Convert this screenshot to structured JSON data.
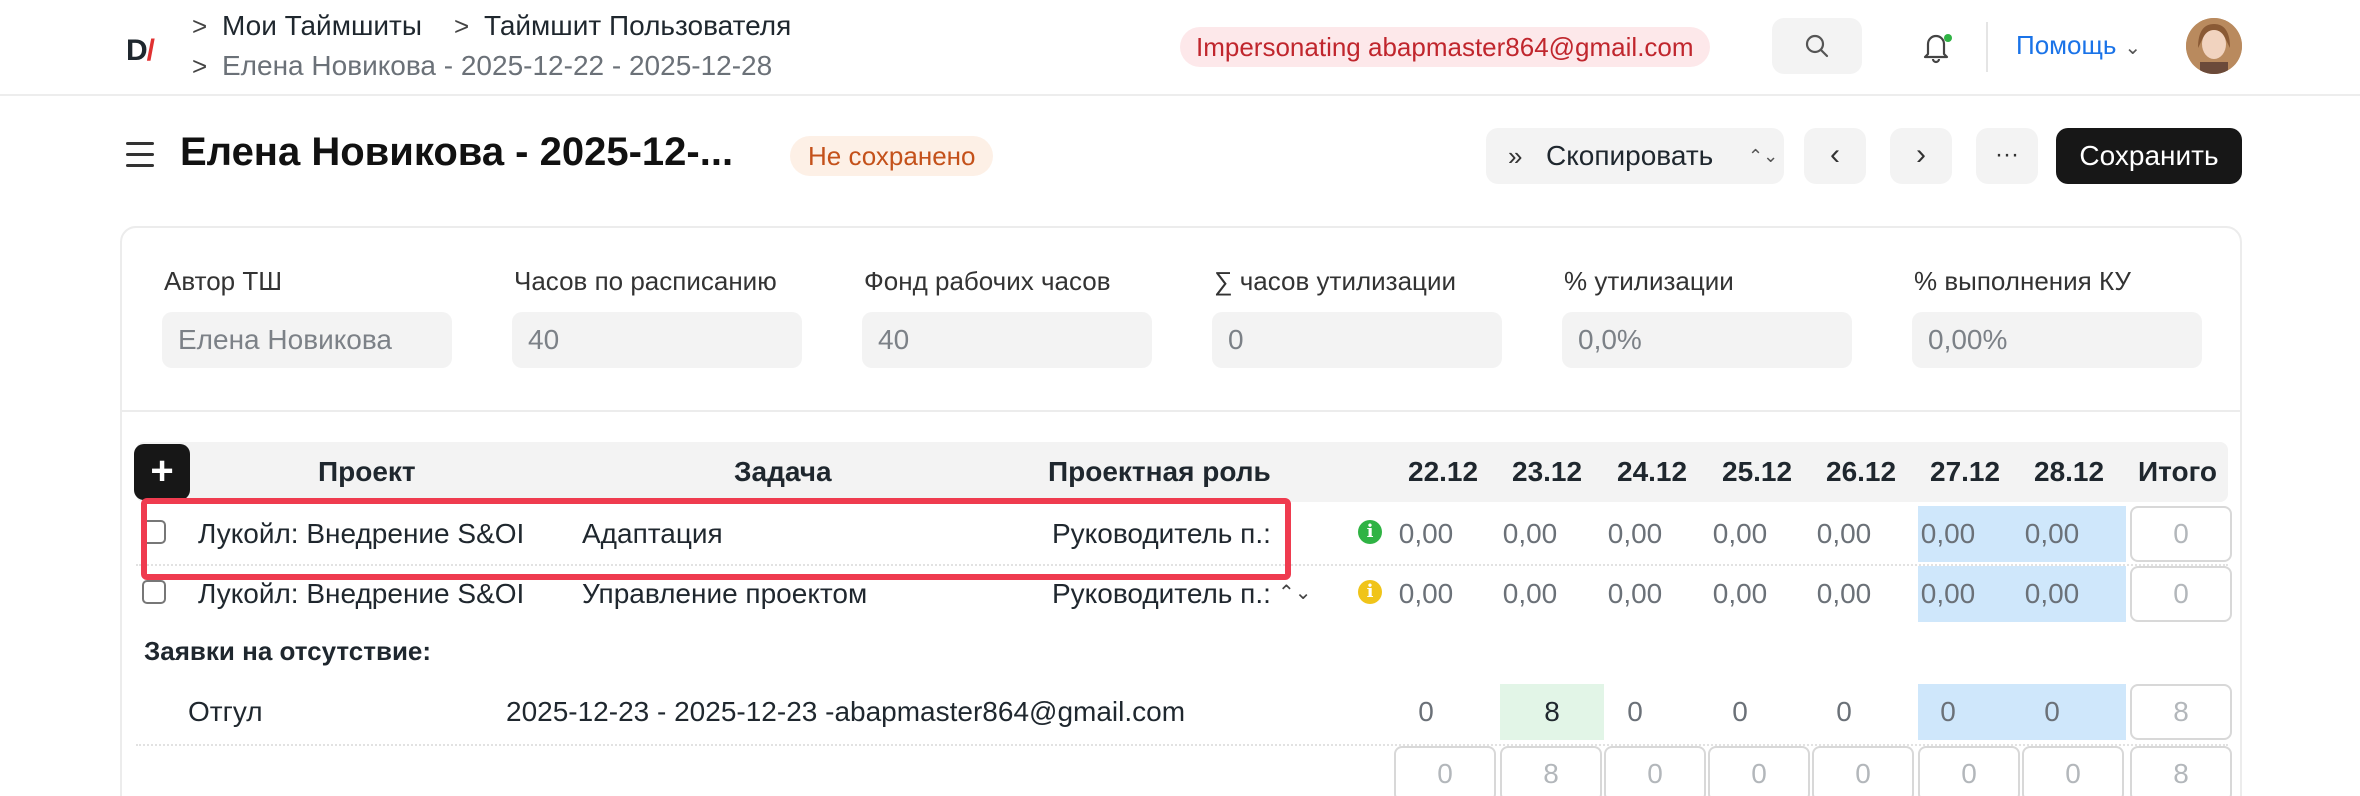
{
  "navbar": {
    "logo_text": "D",
    "logo_slash": "/",
    "breadcrumbs": [
      "Мои Таймшиты",
      "Таймшит Пользователя",
      "Елена Новикова - 2025-12-22 - 2025-12-28"
    ],
    "crumb_separator": ">",
    "impersonation_badge": "Impersonating abapmaster864@gmail.com",
    "help_label": "Помощь",
    "icons": [
      "search-icon",
      "bell-icon",
      "chevron-down-icon",
      "avatar"
    ]
  },
  "header": {
    "title": "Елена Новикова - 2025-12-...",
    "status": "Не сохранено",
    "copy_label": "Скопировать",
    "copy_lead": "»",
    "updown": "⌃⌄",
    "prev": "‹",
    "next": "›",
    "more": "···",
    "save_label": "Сохранить"
  },
  "summary_fields": [
    {
      "label": "Автор ТШ",
      "value": "Елена Новикова"
    },
    {
      "label": "Часов по расписанию",
      "value": "40"
    },
    {
      "label": "Фонд рабочих часов",
      "value": "40"
    },
    {
      "label": "∑ часов утилизации",
      "value": "0"
    },
    {
      "label": "% утилизации",
      "value": "0,0%"
    },
    {
      "label": "% выполнения КУ",
      "value": "0,00%"
    }
  ],
  "grid": {
    "add_label": "+",
    "columns": {
      "project": "Проект",
      "task": "Задача",
      "role": "Проектная роль",
      "days": [
        "22.12",
        "23.12",
        "24.12",
        "25.12",
        "26.12",
        "27.12",
        "28.12"
      ],
      "total": "Итого"
    },
    "rows": [
      {
        "project": "Лукойл: Внедрение S&OI",
        "task": "Адаптация",
        "role": "Руководитель п.:",
        "info": "i",
        "hours": [
          "0,00",
          "0,00",
          "0,00",
          "0,00",
          "0,00",
          "0,00",
          "0,00"
        ],
        "total": "0"
      },
      {
        "project": "Лукойл: Внедрение S&OI",
        "task": "Управление проектом",
        "role": "Руководитель п.:",
        "info": "i",
        "hours": [
          "0,00",
          "0,00",
          "0,00",
          "0,00",
          "0,00",
          "0,00",
          "0,00"
        ],
        "total": "0"
      }
    ],
    "absence_section_label": "Заявки на отсутствие:",
    "absence_rows": [
      {
        "type": "Отгул",
        "period": "2025-12-23 - 2025-12-23 -abapmaster864@gmail.com",
        "hours": [
          "0",
          "8",
          "0",
          "0",
          "0",
          "0",
          "0"
        ],
        "total": "8"
      }
    ],
    "totals_row": {
      "hours": [
        "0",
        "8",
        "0",
        "0",
        "0",
        "0",
        "0"
      ],
      "total": "8"
    }
  },
  "colors": {
    "accent": "#1a73e8",
    "impersonation_bg": "#fde8ea",
    "impersonation_text": "#c0262d",
    "status_bg": "#fdf0e6",
    "status_text": "#c4511a",
    "weekend_shade": "#cfe7fb",
    "absence_shade": "#e2f5e7",
    "highlight": "#ef3b4f",
    "info_green": "#2fb344",
    "info_yellow": "#f0c419"
  }
}
